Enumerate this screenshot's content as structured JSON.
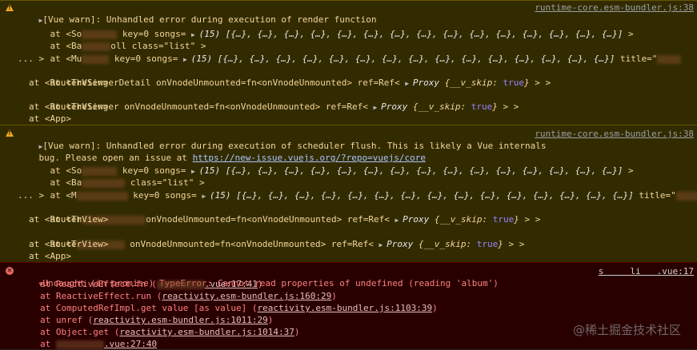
{
  "warning1": {
    "title": "[Vue warn]: Unhandled error during execution of render function",
    "source": "runtime-core.esm-bundler.js:38",
    "l1_pre": "at <So",
    "l1_post": " key=0 songs= ",
    "array15": "(15) [{…}, {…}, {…}, {…}, {…}, {…}, {…}, {…}, {…}, {…}, {…}, {…}, {…}, {…}, {…}]",
    "close": " >",
    "l2_pre": "at <Ba",
    "l2_post": "oll class=\"list\" >",
    "l3_pre": "at <Mu",
    "l3_post": " key=0 songs= ",
    "l3_title": " title=\"",
    "ellipsis": "... >",
    "l4": "at <TheSingerDetail onVnodeUnmounted=fn<onVnodeUnmounted> ref=Ref< ",
    "proxy_label": "Proxy",
    "proxy_body_pre": " {__v_skip: ",
    "proxy_true": "true",
    "proxy_body_post": "}",
    "proxy_close": " > >",
    "l5": "at <RouterView>",
    "l6": "at <TheSinger onVnodeUnmounted=fn<onVnodeUnmounted> ref=Ref< ",
    "l7": "at <RouterView>",
    "l8": "at <App>"
  },
  "warning2": {
    "title": "[Vue warn]: Unhandled error during execution of scheduler flush. This is likely a Vue internals",
    "source": "runtime-core.esm-bundler.js:38",
    "title2_pre": "bug. Please open an issue at ",
    "issue_link": "https://new-issue.vuejs.org/?repo=vuejs/core",
    "l1_pre": "at <So",
    "l1_post": " key=0 songs= ",
    "l2_pre": "at <Ba",
    "l2_post": " class=\"list\" >",
    "l3_pre": "at <M",
    "l3_post": " key=0 songs= ",
    "l3_title": " title=\"",
    "l3_end": "\"",
    "l4_pre": "at <Th",
    "l4_post": "onVnodeUnmounted=fn<onVnodeUnmounted> ref=Ref< ",
    "l5": "at <RouterView>",
    "l6_pre": "at <T",
    "l6_post": " onVnodeUnmounted=fn<onVnodeUnmounted> ref=Ref< ",
    "l7": "at <RouterView>",
    "l8": "at <App>"
  },
  "error": {
    "title": "Uncaught (in promise) TypeError: Cannot read properties of undefined (reading 'album')",
    "source": "s     li   .vue:17",
    "frames": [
      {
        "pre": "at ReactiveEffect.fn (",
        "link": ".vue:17:41",
        "post": ")",
        "blurred": true
      },
      {
        "pre": "at ReactiveEffect.run (",
        "link": "reactivity.esm-bundler.js:160:29",
        "post": ")",
        "blurred": false
      },
      {
        "pre": "at ComputedRefImpl.get value [as value] (",
        "link": "reactivity.esm-bundler.js:1103:39",
        "post": ")",
        "blurred": false
      },
      {
        "pre": "at unref (",
        "link": "reactivity.esm-bundler.js:1011:29",
        "post": ")",
        "blurred": false
      },
      {
        "pre": "at Object.get (",
        "link": "reactivity.esm-bundler.js:1014:37",
        "post": ")",
        "blurred": false
      },
      {
        "pre": "at ",
        "link": ".vue:27:40",
        "post": "",
        "blurred": true
      }
    ]
  },
  "watermark": "@稀土掘金技术社区",
  "colors": {
    "warn_bg": "#332b00",
    "err_bg": "#290000",
    "warn_text": "#f2d69c",
    "err_text": "#ff8080"
  }
}
